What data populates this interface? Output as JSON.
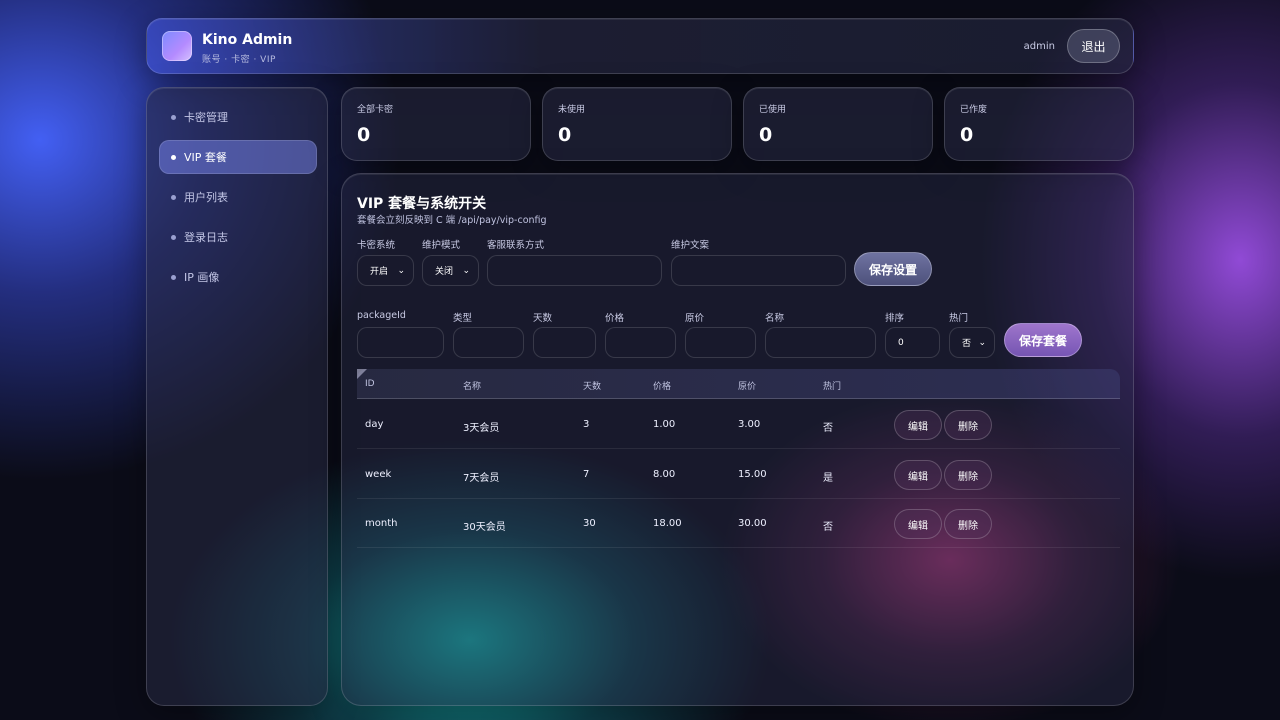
{
  "header": {
    "title": "Kino Admin",
    "subtitle": "账号 · 卡密 · VIP",
    "user": "admin",
    "logout_label": "退出"
  },
  "sidebar": {
    "items": [
      {
        "label": "卡密管理"
      },
      {
        "label": "VIP 套餐"
      },
      {
        "label": "用户列表"
      },
      {
        "label": "登录日志"
      },
      {
        "label": "IP 画像"
      }
    ]
  },
  "stats": [
    {
      "label": "全部卡密",
      "value": "0"
    },
    {
      "label": "未使用",
      "value": "0"
    },
    {
      "label": "已使用",
      "value": "0"
    },
    {
      "label": "已作废",
      "value": "0"
    }
  ],
  "panel": {
    "title": "VIP 套餐与系统开关",
    "subtitle": "套餐会立刻反映到 C 端 /api/pay/vip-config",
    "settings": {
      "card_system_label": "卡密系统",
      "card_system_value": "开启",
      "maintenance_label": "维护模式",
      "maintenance_value": "关闭",
      "contact_label": "客服联系方式",
      "contact_value": "",
      "maintenance_text_label": "维护文案",
      "maintenance_text_value": "",
      "save_label": "保存设置"
    },
    "package_form": {
      "package_id_label": "packageId",
      "package_id_value": "",
      "type_label": "类型",
      "type_value": "",
      "days_label": "天数",
      "days_value": "",
      "price_label": "价格",
      "price_value": "",
      "original_label": "原价",
      "original_value": "",
      "name_label": "名称",
      "name_value": "",
      "sort_label": "排序",
      "sort_value": "0",
      "hot_label": "热门",
      "hot_value": "否",
      "save_label": "保存套餐"
    },
    "table": {
      "headers": [
        "ID",
        "名称",
        "天数",
        "价格",
        "原价",
        "热门"
      ],
      "edit_label": "编辑",
      "delete_label": "删除",
      "rows": [
        [
          "day",
          "3天会员",
          "3",
          "1.00",
          "3.00",
          "否"
        ],
        [
          "week",
          "7天会员",
          "7",
          "8.00",
          "15.00",
          "是"
        ],
        [
          "month",
          "30天会员",
          "30",
          "18.00",
          "30.00",
          "否"
        ]
      ]
    }
  }
}
